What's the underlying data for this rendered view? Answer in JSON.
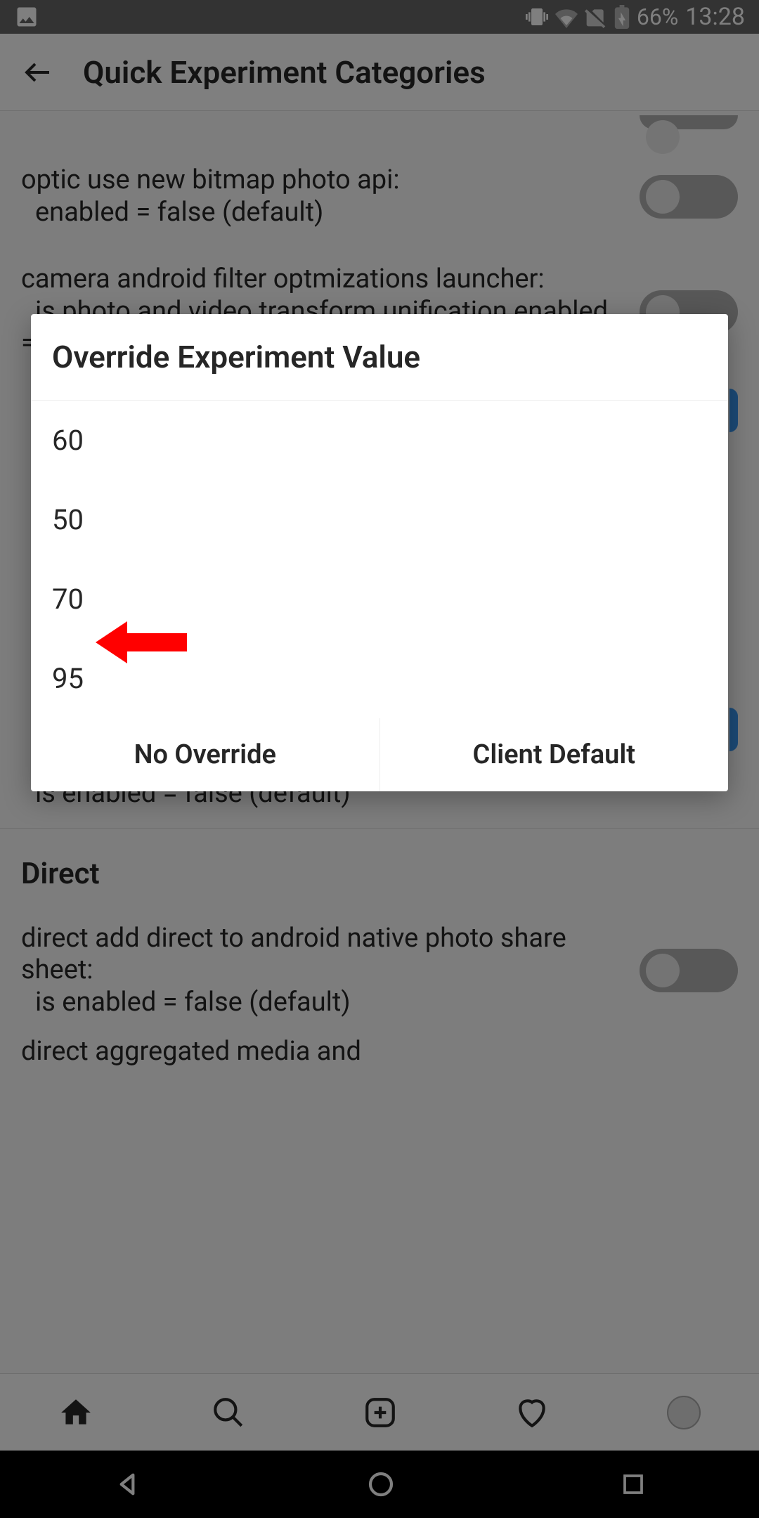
{
  "status_bar": {
    "battery_text": "66%",
    "time": "13:28"
  },
  "header": {
    "title": "Quick Experiment Categories"
  },
  "experiments": {
    "item1_line1": "optic use new bitmap photo api:",
    "item1_line2": "enabled = false (default)",
    "item2_line1": "camera android filter optmizations launcher:",
    "item2_line2": "is photo and video transform unification enabled = false (default)",
    "item3_partial": "is enabled = false (default)",
    "section_direct": "Direct",
    "direct_line1": "direct add direct to android native photo share sheet:",
    "direct_line2": "is enabled = false (default)",
    "direct_item2": "direct aggregated media and"
  },
  "dialog": {
    "title": "Override Experiment Value",
    "options": [
      "60",
      "50",
      "70",
      "95"
    ],
    "action_no_override": "No Override",
    "action_client_default": "Client Default"
  }
}
